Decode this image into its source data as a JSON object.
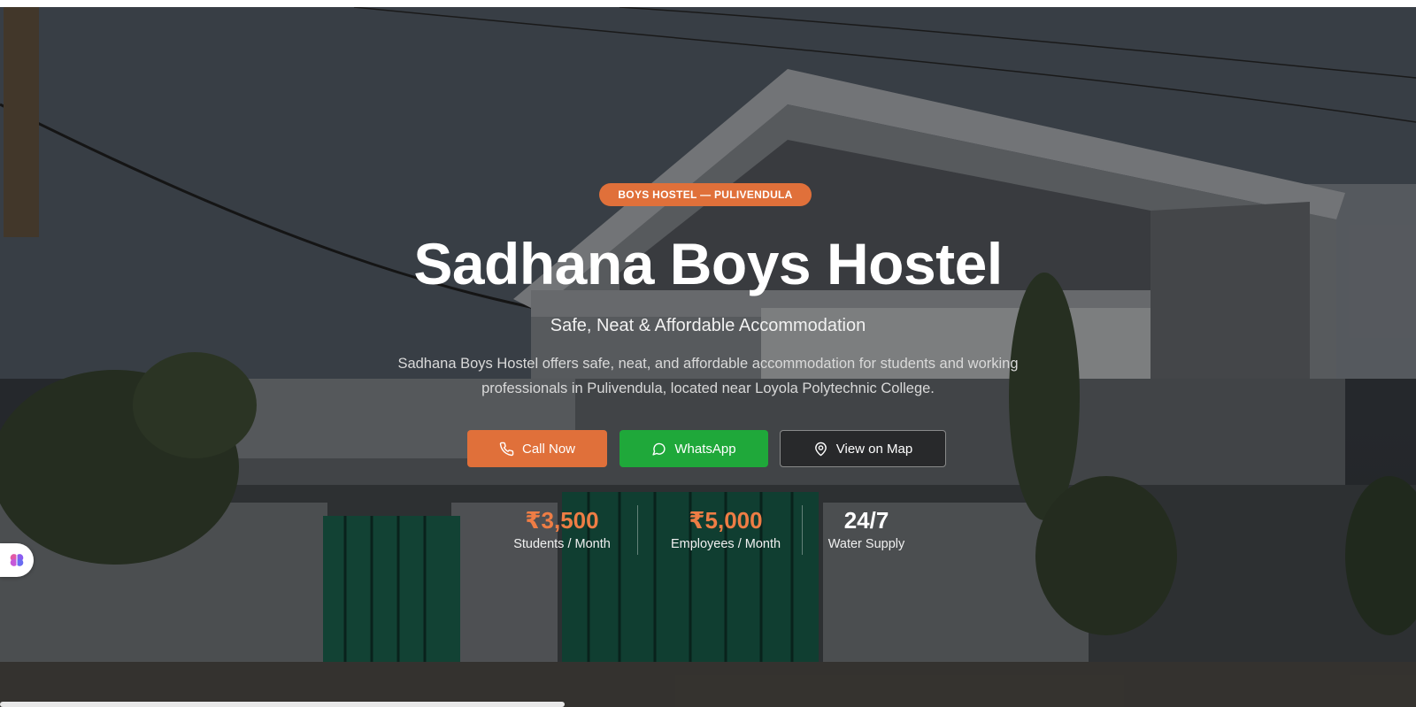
{
  "hero": {
    "badge": "BOYS HOSTEL — PULIVENDULA",
    "title": "Sadhana Boys Hostel",
    "subtitle": "Safe, Neat & Affordable Accommodation",
    "description": "Sadhana Boys Hostel offers safe, neat, and affordable accommodation for students and working professionals in Pulivendula, located near Loyola Polytechnic College."
  },
  "buttons": {
    "call": {
      "label": "Call Now",
      "icon": "phone-icon"
    },
    "whatsapp": {
      "label": "WhatsApp",
      "icon": "whatsapp-icon"
    },
    "map": {
      "label": "View on Map",
      "icon": "map-pin-icon"
    }
  },
  "stats": [
    {
      "value": "₹3,500",
      "label": "Students / Month"
    },
    {
      "value": "₹5,000",
      "label": "Employees / Month"
    },
    {
      "value": "24/7",
      "label": "Water Supply"
    }
  ],
  "colors": {
    "accent": "#e0703a",
    "whatsapp": "#1fa83a",
    "price": "#ee7d45"
  },
  "floating_widget": {
    "icon": "brain-icon"
  }
}
